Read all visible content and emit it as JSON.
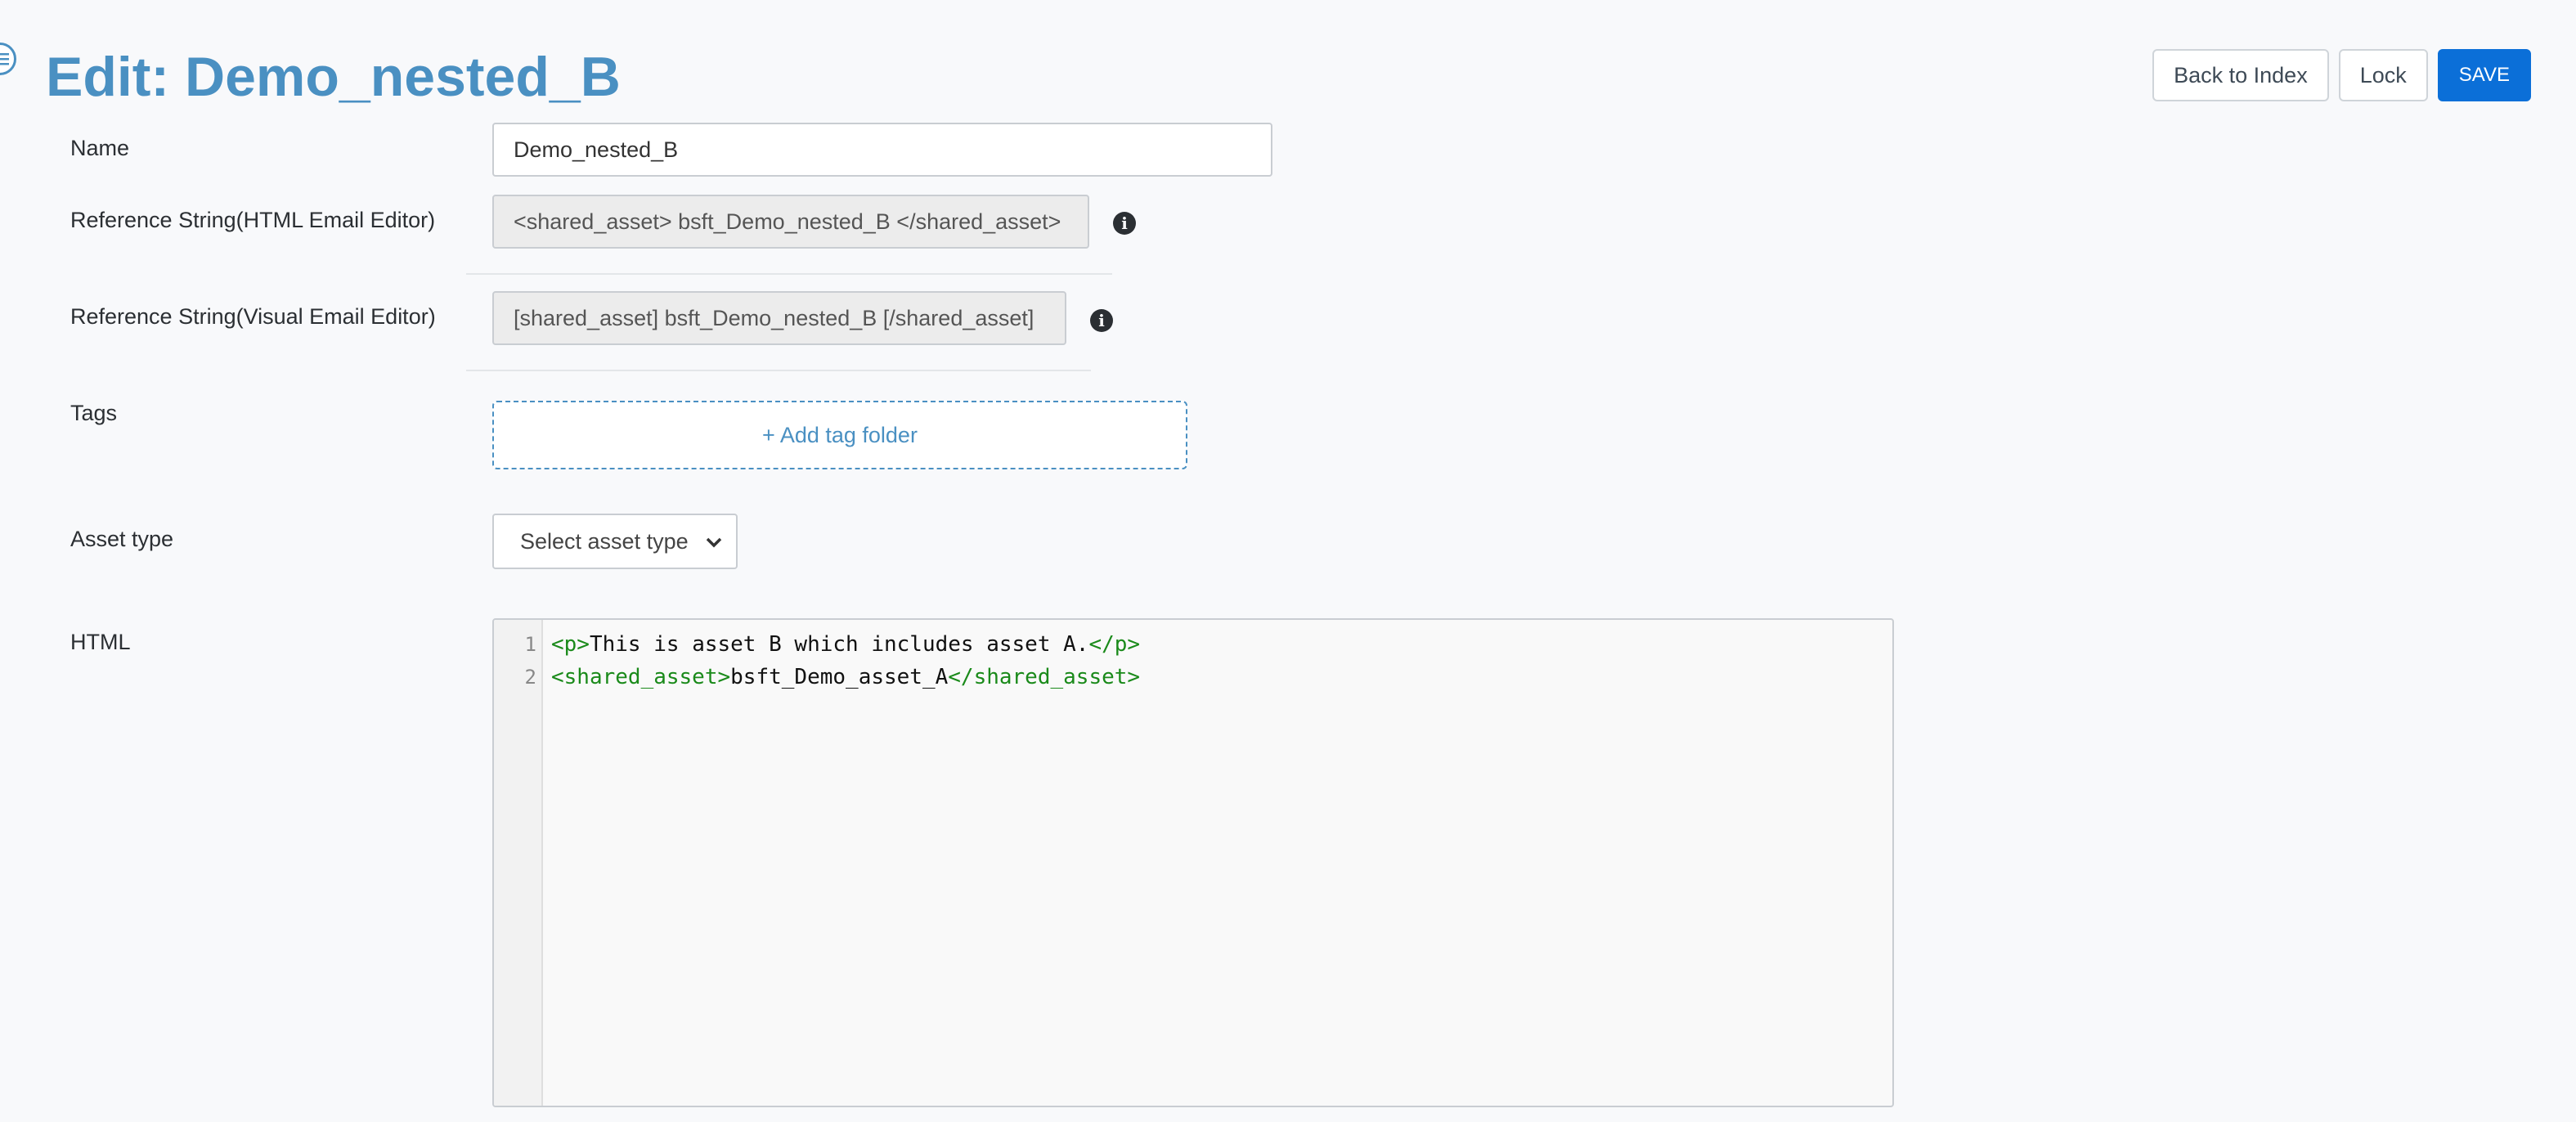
{
  "page": {
    "title": "Edit: Demo_nested_B"
  },
  "toolbar": {
    "back_label": "Back to Index",
    "lock_label": "Lock",
    "save_label": "SAVE"
  },
  "form": {
    "name_label": "Name",
    "name_value": "Demo_nested_B",
    "ref_html_label": "Reference String(HTML Email Editor)",
    "ref_html_value": "<shared_asset> bsft_Demo_nested_B </shared_asset>",
    "ref_visual_label": "Reference String(Visual Email Editor)",
    "ref_visual_value": "[shared_asset] bsft_Demo_nested_B [/shared_asset]",
    "tags_label": "Tags",
    "add_tag_label": "+ Add tag folder",
    "asset_type_label": "Asset type",
    "asset_type_value": "Select asset type",
    "html_label": "HTML"
  },
  "editor": {
    "lines": [
      {
        "num": "1",
        "segments": [
          {
            "t": "tag",
            "v": "<p>"
          },
          {
            "t": "txt",
            "v": "This is asset B which includes asset A."
          },
          {
            "t": "tag",
            "v": "</p>"
          }
        ]
      },
      {
        "num": "2",
        "segments": [
          {
            "t": "tag",
            "v": "<shared_asset>"
          },
          {
            "t": "txt",
            "v": "bsft_Demo_asset_A"
          },
          {
            "t": "tag",
            "v": "</shared_asset>"
          }
        ]
      }
    ]
  },
  "colors": {
    "accent": "#4a90c2",
    "primary_button": "#0b6fd8",
    "code_tag": "#1a8a1a"
  },
  "icons": [
    "menu-icon",
    "info-icon",
    "chevron-down-icon"
  ]
}
